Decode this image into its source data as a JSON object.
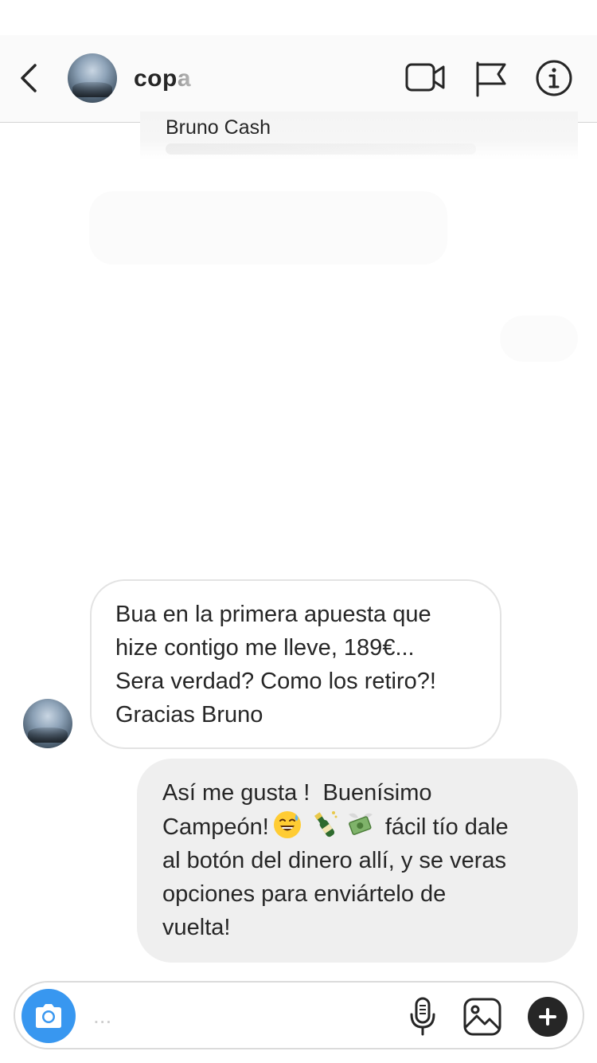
{
  "header": {
    "username": "copa",
    "icons": [
      "back-icon",
      "video-call-icon",
      "flag-icon",
      "info-icon"
    ]
  },
  "forwarded_post": {
    "name": "Bruno Cash"
  },
  "messages": [
    {
      "sender": "contact",
      "text": "Bua en la primera apuesta que\nhize contigo me lleve, 189€...\nSera verdad? Como los retiro?!\nGracias Bruno"
    },
    {
      "sender": "me",
      "line1": "Así me gusta !  Buenísimo",
      "line2_start": "Campeón!",
      "line2_end": "fácil tío dale",
      "rest": "al botón del dinero allí, y se veras\nopciones para enviártelo de\nvuelta!",
      "emojis": [
        "grinning-sweat-emoji",
        "champagne-emoji",
        "money-with-wings-emoji"
      ]
    }
  ],
  "composer": {
    "placeholder": "...",
    "icons": [
      "camera-icon",
      "microphone-icon",
      "gallery-icon",
      "plus-icon"
    ]
  },
  "colors": {
    "accent": "#3897f0",
    "incoming_border": "#e3e3e3",
    "outgoing_bg": "#efefef",
    "text": "#262626"
  }
}
